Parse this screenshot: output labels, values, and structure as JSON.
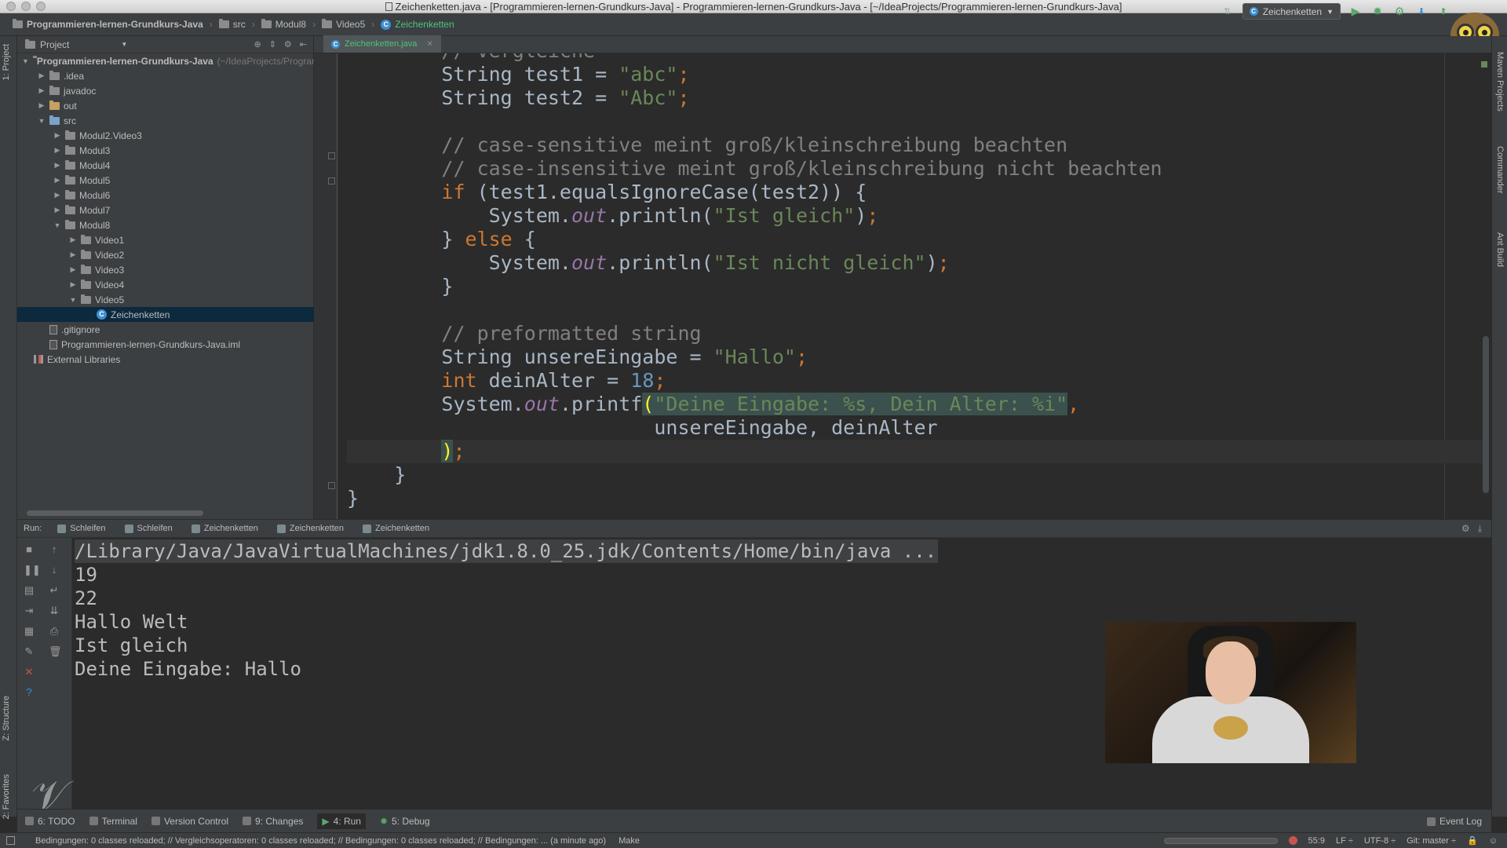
{
  "window": {
    "title": "Zeichenketten.java - [Programmieren-lernen-Grundkurs-Java] - Programmieren-lernen-Grundkurs-Java - [~/IdeaProjects/Programmieren-lernen-Grundkurs-Java]"
  },
  "breadcrumbs": [
    "Programmieren-lernen-Grundkurs-Java",
    "src",
    "Modul8",
    "Video5",
    "Zeichenketten"
  ],
  "run_config": "Zeichenketten",
  "toolbar_icons": [
    "run-icon",
    "debug-icon",
    "coverage-icon",
    "vcs-update-icon",
    "vcs-commit-icon"
  ],
  "project_panel": {
    "title": "Project",
    "root": "Programmieren-lernen-Grundkurs-Java",
    "root_path": "(~/IdeaProjects/Programmieren-lernen-Grundkurs-Java)",
    "nodes": [
      {
        "label": ".idea",
        "depth": 1,
        "arrow": "▶",
        "icon": "folder"
      },
      {
        "label": "javadoc",
        "depth": 1,
        "arrow": "▶",
        "icon": "folder"
      },
      {
        "label": "out",
        "depth": 1,
        "arrow": "▶",
        "icon": "folder-out"
      },
      {
        "label": "src",
        "depth": 1,
        "arrow": "▼",
        "icon": "folder-src"
      },
      {
        "label": "Modul2.Video3",
        "depth": 2,
        "arrow": "▶",
        "icon": "package"
      },
      {
        "label": "Modul3",
        "depth": 2,
        "arrow": "▶",
        "icon": "package"
      },
      {
        "label": "Modul4",
        "depth": 2,
        "arrow": "▶",
        "icon": "package"
      },
      {
        "label": "Modul5",
        "depth": 2,
        "arrow": "▶",
        "icon": "package"
      },
      {
        "label": "Modul6",
        "depth": 2,
        "arrow": "▶",
        "icon": "package"
      },
      {
        "label": "Modul7",
        "depth": 2,
        "arrow": "▶",
        "icon": "package"
      },
      {
        "label": "Modul8",
        "depth": 2,
        "arrow": "▼",
        "icon": "package"
      },
      {
        "label": "Video1",
        "depth": 3,
        "arrow": "▶",
        "icon": "package"
      },
      {
        "label": "Video2",
        "depth": 3,
        "arrow": "▶",
        "icon": "package"
      },
      {
        "label": "Video3",
        "depth": 3,
        "arrow": "▶",
        "icon": "package"
      },
      {
        "label": "Video4",
        "depth": 3,
        "arrow": "▶",
        "icon": "package"
      },
      {
        "label": "Video5",
        "depth": 3,
        "arrow": "▼",
        "icon": "package"
      },
      {
        "label": "Zeichenketten",
        "depth": 4,
        "arrow": "",
        "icon": "class",
        "selected": true
      },
      {
        "label": ".gitignore",
        "depth": 1,
        "arrow": "",
        "icon": "file"
      },
      {
        "label": "Programmieren-lernen-Grundkurs-Java.iml",
        "depth": 1,
        "arrow": "",
        "icon": "iml"
      },
      {
        "label": "External Libraries",
        "depth": 0,
        "arrow": "",
        "icon": "library"
      }
    ]
  },
  "editor": {
    "tab_label": "Zeichenketten.java",
    "lines": [
      [
        [
          "cm",
          "// Vergleiche"
        ]
      ],
      [
        [
          "",
          "String test1 = "
        ],
        [
          "str",
          "\"abc\""
        ],
        [
          "kw",
          ";"
        ]
      ],
      [
        [
          "",
          "String test2 = "
        ],
        [
          "str",
          "\"Abc\""
        ],
        [
          "kw",
          ";"
        ]
      ],
      [],
      [
        [
          "cm",
          "// case-sensitive meint groß/kleinschreibung beachten"
        ]
      ],
      [
        [
          "cm",
          "// case-insensitive meint groß/kleinschreibung nicht beachten"
        ]
      ],
      [
        [
          "kw",
          "if "
        ],
        [
          "",
          "(test1.equalsIgnoreCase(test2)) {"
        ]
      ],
      [
        [
          "",
          "    System."
        ],
        [
          "it",
          "out"
        ],
        [
          "",
          ".println("
        ],
        [
          "str",
          "\"Ist gleich\""
        ],
        [
          "",
          ")"
        ],
        [
          "kw",
          ";"
        ]
      ],
      [
        [
          "",
          "} "
        ],
        [
          "kw",
          "else "
        ],
        [
          "",
          "{"
        ]
      ],
      [
        [
          "",
          "    System."
        ],
        [
          "it",
          "out"
        ],
        [
          "",
          ".println("
        ],
        [
          "str",
          "\"Ist nicht gleich\""
        ],
        [
          "",
          ")"
        ],
        [
          "kw",
          ";"
        ]
      ],
      [
        [
          "",
          "}"
        ]
      ],
      [],
      [
        [
          "cm",
          "// preformatted string"
        ]
      ],
      [
        [
          "",
          "String unsereEingabe = "
        ],
        [
          "str",
          "\"Hallo\""
        ],
        [
          "kw",
          ";"
        ]
      ],
      [
        [
          "kw",
          "int "
        ],
        [
          "",
          "deinAlter = "
        ],
        [
          "num",
          "18"
        ],
        [
          "kw",
          ";"
        ]
      ],
      [
        [
          "",
          "System."
        ],
        [
          "it",
          "out"
        ],
        [
          "",
          ".printf"
        ],
        [
          "brk",
          "("
        ],
        [
          "str hl",
          "\"Deine Eingabe: %s, Dein Alter: %i\""
        ],
        [
          "kw",
          ","
        ]
      ],
      [
        [
          "",
          "                  unsereEingabe, deinAlter"
        ]
      ],
      [
        [
          "brk",
          ")"
        ],
        [
          "kw",
          ";"
        ]
      ]
    ],
    "closing_lines": [
      "    }",
      "}"
    ]
  },
  "run_panel": {
    "label": "Run:",
    "tabs": [
      "Schleifen",
      "Schleifen",
      "Zeichenketten",
      "Zeichenketten",
      "Zeichenketten"
    ],
    "console": [
      "/Library/Java/JavaVirtualMachines/jdk1.8.0_25.jdk/Contents/Home/bin/java ...",
      "19",
      "22",
      "Hallo Welt",
      "Ist gleich",
      "Deine Eingabe: Hallo"
    ]
  },
  "tool_windows": [
    {
      "label": "6: TODO",
      "icon": "todo-icon"
    },
    {
      "label": "Terminal",
      "icon": "terminal-icon"
    },
    {
      "label": "Version Control",
      "icon": "version-control-icon"
    },
    {
      "label": "9: Changes",
      "icon": "changes-icon"
    },
    {
      "label": "4: Run",
      "icon": "run-icon",
      "active": true
    },
    {
      "label": "5: Debug",
      "icon": "debug-icon"
    }
  ],
  "event_log": "Event Log",
  "left_strip": {
    "project": "1: Project",
    "structure": "Z: Structure",
    "favorites": "2: Favorites"
  },
  "right_strip": {
    "maven": "Maven Projects",
    "commander": "Commander",
    "ant": "Ant Build"
  },
  "status": {
    "message": "Bedingungen: 0 classes reloaded; // Vergleichsoperatoren: 0 classes reloaded; // Bedingungen: 0 classes reloaded; // Bedingungen: ... (a minute ago)",
    "make": "Make",
    "position": "55:9",
    "line_sep": "LF ÷",
    "encoding": "UTF-8 ÷",
    "vcs": "Git: master ÷"
  },
  "colors": {
    "background": "#2b2b2b",
    "panel": "#3c3f41",
    "keyword": "#cc7832",
    "string": "#6a8759",
    "number": "#6897bb",
    "comment": "#808080",
    "field": "#9876aa"
  }
}
